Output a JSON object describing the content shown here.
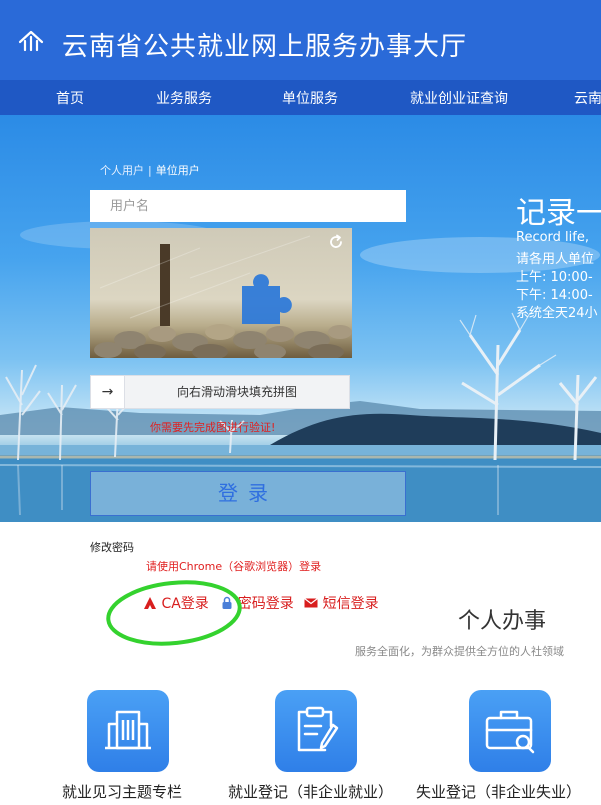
{
  "header": {
    "site_title": "云南省公共就业网上服务办事大厅",
    "logo_icon": "house-arrow-logo"
  },
  "nav": {
    "items": [
      "首页",
      "业务服务",
      "单位服务",
      "就业创业证查询",
      "云南"
    ]
  },
  "login": {
    "tab_personal": "个人用户",
    "tab_separator": "|",
    "tab_unit": "单位用户",
    "username_placeholder": "用户名",
    "slider_arrow": "→",
    "slider_text": "向右滑动滑块填充拼图",
    "verify_message": "你需要先完成图进行验证!",
    "login_button": "登录",
    "change_password": "修改密码",
    "chrome_tip": "请使用Chrome（谷歌浏览器）登录"
  },
  "slogan": {
    "title": "记录一",
    "line1": "Record life,",
    "line2": "请各用人单位",
    "line3": "上午: 10:00-",
    "line4": "下午: 14:00-",
    "line5": "系统全天24小"
  },
  "login_modes": {
    "ca": "CA登录",
    "password": "密码登录",
    "sms": "短信登录"
  },
  "services": {
    "title": "个人办事",
    "subtitle": "服务全面化，为群众提供全方位的人社领域",
    "tiles": [
      {
        "label": "就业见习主题专栏",
        "icon": "building-icon"
      },
      {
        "label": "就业登记（非企业就业）",
        "icon": "clipboard-edit-icon"
      },
      {
        "label": "失业登记（非企业失业）",
        "icon": "briefcase-search-icon"
      }
    ]
  },
  "colors": {
    "header_blue": "#2a6ad8",
    "nav_blue": "#1f58c4",
    "alert_red": "#e02020",
    "highlight_green": "#34d22e",
    "tile_blue": "#2f7fe8"
  }
}
